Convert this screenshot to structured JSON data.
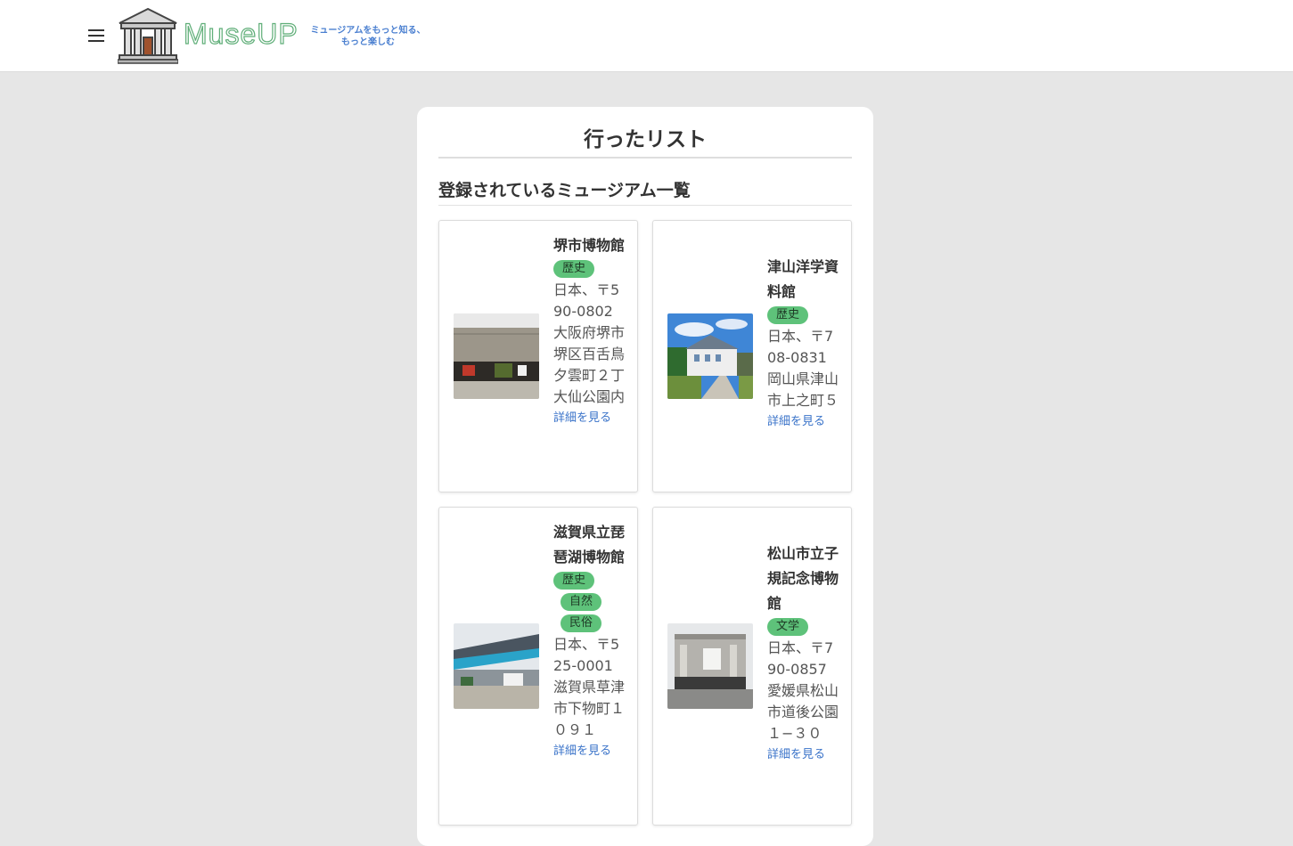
{
  "header": {
    "logo_text": "MuseUP",
    "tagline_line1": "ミュージアムをもっと知る、",
    "tagline_line2": "もっと楽しむ"
  },
  "page": {
    "title": "行ったリスト",
    "section_title": "登録されているミュージアム一覧"
  },
  "museums": [
    {
      "name": "堺市博物館",
      "tags": [
        "歴史"
      ],
      "address": "日本、〒590-0802 大阪府堺市堺区百舌鳥夕雲町２丁 大仙公園内",
      "link": "詳細を見る"
    },
    {
      "name": "津山洋学資料館",
      "tags": [
        "歴史"
      ],
      "address": "日本、〒708-0831 岡山県津山市上之町５",
      "link": "詳細を見る"
    },
    {
      "name": "滋賀県立琵琶湖博物館",
      "tags": [
        "歴史",
        "自然",
        "民俗"
      ],
      "address": "日本、〒525-0001 滋賀県草津市下物町１０９１",
      "link": "詳細を見る"
    },
    {
      "name": "松山市立子規記念博物館",
      "tags": [
        "文学"
      ],
      "address": "日本、〒790-0857 愛媛県松山市道後公園１−３０",
      "link": "詳細を見る"
    }
  ]
}
